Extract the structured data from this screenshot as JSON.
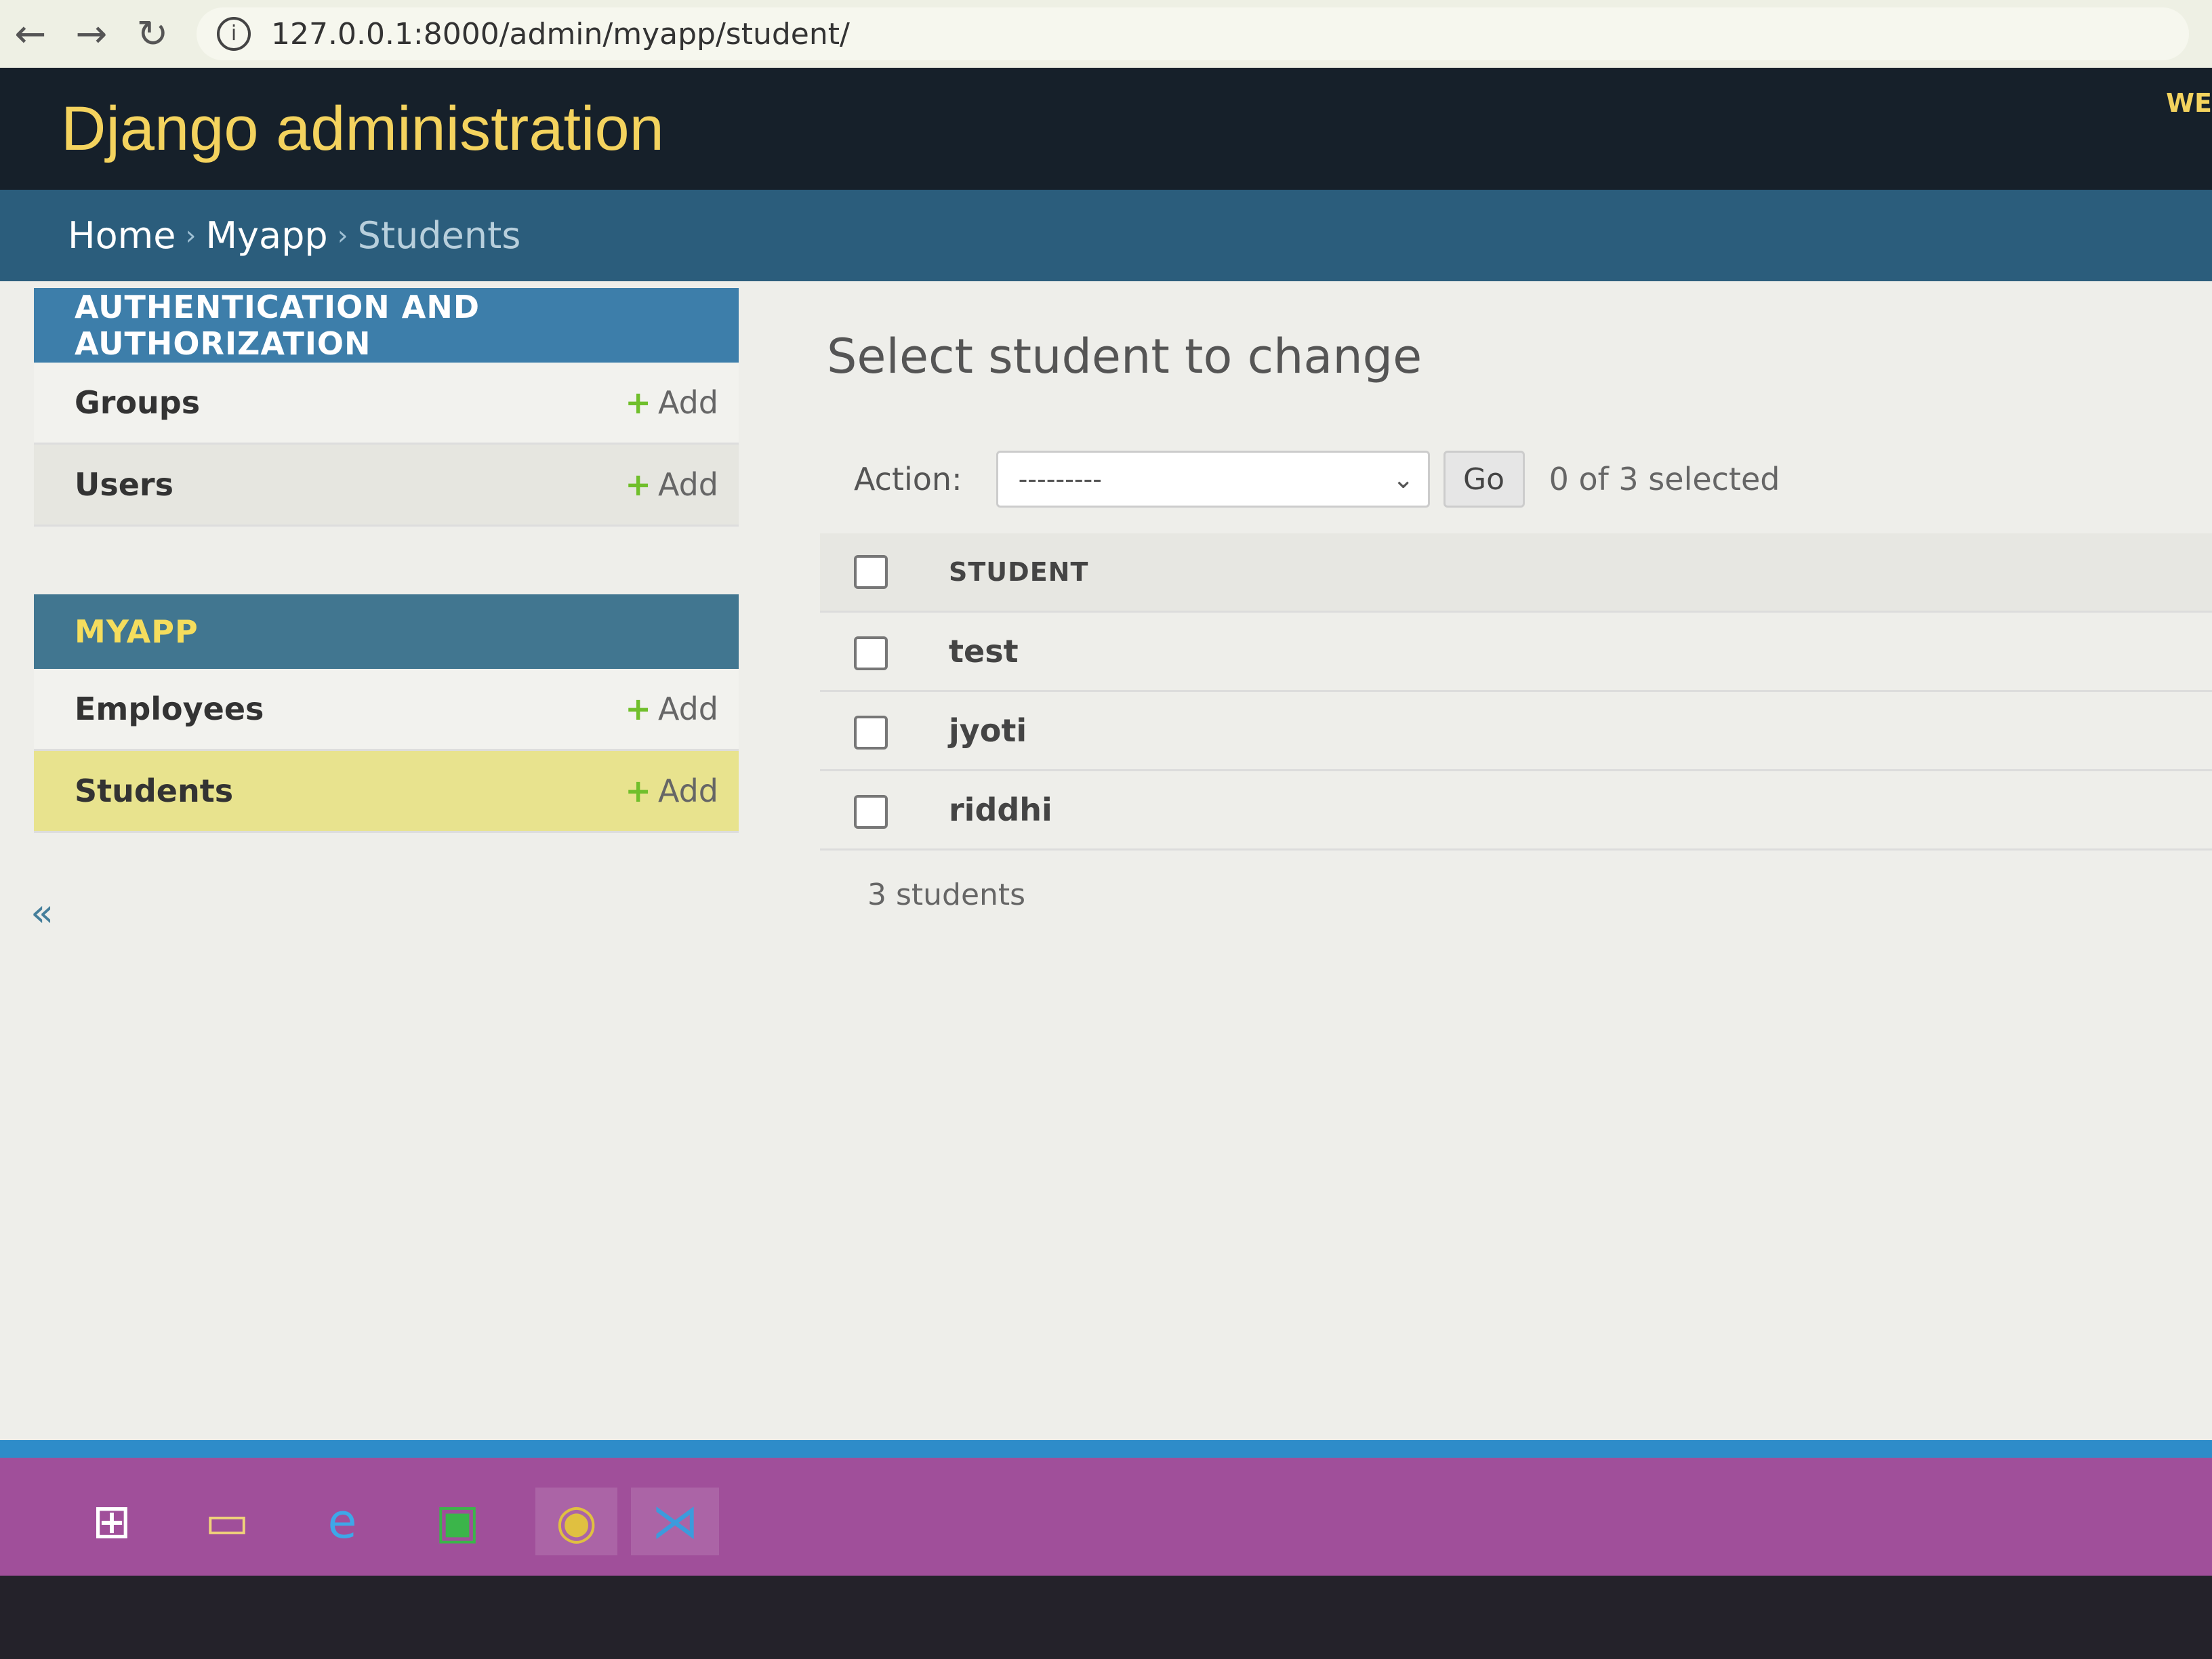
{
  "browser": {
    "url": "127.0.0.1:8000/admin/myapp/student/"
  },
  "header": {
    "brand": "Django administration",
    "user_tools": "WE"
  },
  "breadcrumbs": {
    "home": "Home",
    "app": "Myapp",
    "current": "Students",
    "separator": "›"
  },
  "sidebar": {
    "modules": [
      {
        "caption": "AUTHENTICATION AND AUTHORIZATION",
        "rows": [
          {
            "label": "Groups",
            "add": "Add"
          },
          {
            "label": "Users",
            "add": "Add"
          }
        ]
      },
      {
        "caption": "MYAPP",
        "rows": [
          {
            "label": "Employees",
            "add": "Add"
          },
          {
            "label": "Students",
            "add": "Add"
          }
        ]
      }
    ],
    "collapse": "«"
  },
  "content": {
    "title": "Select student to change",
    "action_label": "Action:",
    "action_selected": "---------",
    "go_label": "Go",
    "counter": "0 of 3 selected",
    "column_header": "STUDENT",
    "rows": [
      "test",
      "jyoti",
      "riddhi"
    ],
    "paginator": "3 students"
  },
  "colors": {
    "header_bg": "#16202a",
    "brand": "#f4d35e",
    "breadcrumbs_bg": "#2b5d7c",
    "module_caption": "#3d7eaa",
    "current_row": "#e8e38e",
    "add_plus": "#70bf2b"
  },
  "icons": [
    "back-icon",
    "forward-icon",
    "reload-icon",
    "info-icon",
    "plus-icon",
    "chevron-down-icon",
    "windows-start-icon",
    "file-explorer-icon",
    "internet-explorer-icon",
    "store-icon",
    "chrome-icon",
    "vscode-icon"
  ]
}
